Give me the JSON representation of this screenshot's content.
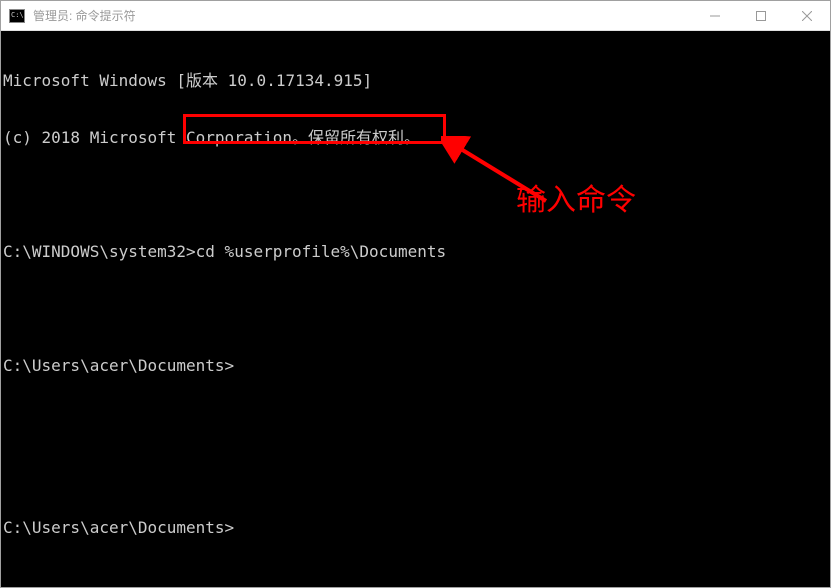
{
  "window": {
    "title": "管理员: 命令提示符"
  },
  "terminal": {
    "line1": "Microsoft Windows [版本 10.0.17134.915]",
    "line2": "(c) 2018 Microsoft Corporation。保留所有权利。",
    "blank1": "",
    "prompt1_path": "C:\\WINDOWS\\system32>",
    "prompt1_command": "cd %userprofile%\\Documents",
    "blank2": "",
    "prompt2": "C:\\Users\\acer\\Documents>",
    "bottom_prompt": "C:\\Users\\acer\\Documents>"
  },
  "annotation": {
    "label": "输入命令",
    "highlight_color": "#ff0000"
  }
}
